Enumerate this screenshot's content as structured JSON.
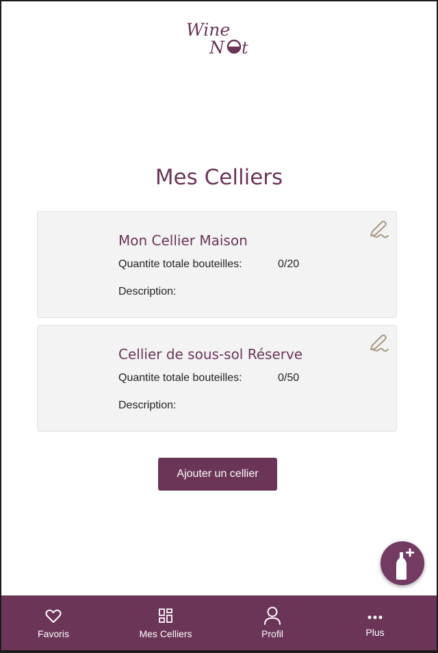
{
  "app": {
    "logo_alt": "Wine Not"
  },
  "page": {
    "title": "Mes Celliers"
  },
  "celliers": [
    {
      "name": "Mon Cellier Maison",
      "qty_label": "Quantite totale bouteilles:",
      "qty_value": "0/20",
      "description_label": "Description:"
    },
    {
      "name": "Cellier de sous-sol Réserve",
      "qty_label": "Quantite totale bouteilles:",
      "qty_value": "0/50",
      "description_label": "Description:"
    }
  ],
  "actions": {
    "add_cellar_label": "Ajouter un cellier",
    "fab_icon": "add-bottle-icon",
    "edit_icon": "pen-icon"
  },
  "nav": {
    "items": [
      {
        "label": "Favoris",
        "icon": "heart-icon"
      },
      {
        "label": "Mes Celliers",
        "icon": "dashboard-icon"
      },
      {
        "label": "Profil",
        "icon": "user-icon"
      },
      {
        "label": "Plus",
        "icon": "more-icon"
      }
    ]
  },
  "colors": {
    "brand": "#6b3558",
    "card_bg": "#f3f3f3",
    "edit_icon": "#a89880"
  }
}
